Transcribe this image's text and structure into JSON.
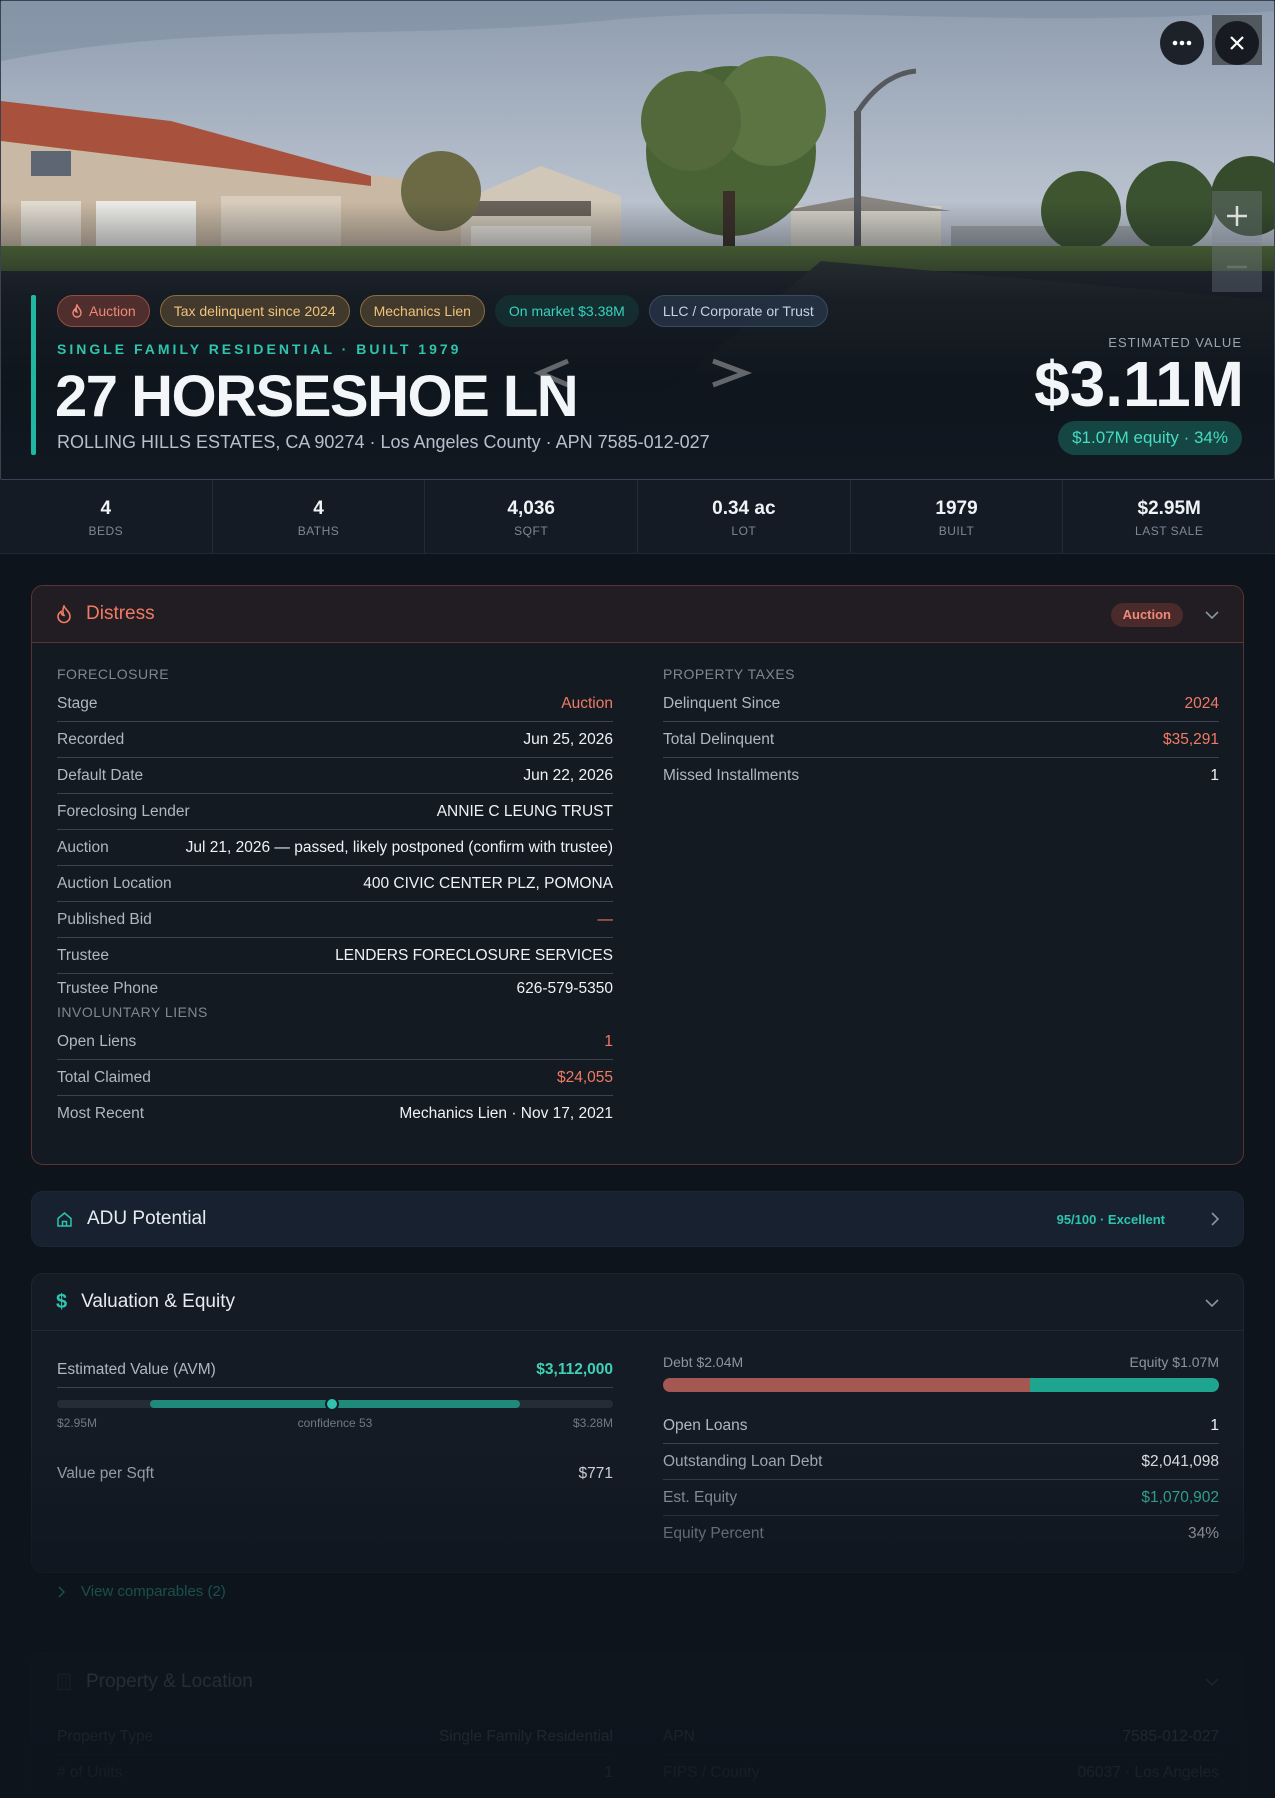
{
  "hero": {
    "tags": [
      {
        "label": "Auction"
      },
      {
        "label": "Tax delinquent since 2024"
      },
      {
        "label": "Mechanics Lien"
      },
      {
        "label": "On market $3.38M"
      },
      {
        "label": "LLC / Corporate or Trust"
      }
    ],
    "subtitle": "SINGLE FAMILY RESIDENTIAL · BUILT 1979",
    "address": "27 HORSESHOE LN",
    "location": "ROLLING HILLS ESTATES, CA 90274 · Los Angeles County · APN 7585-012-027",
    "estimated_label": "ESTIMATED VALUE",
    "estimated_value": "$3.11M",
    "equity": "$1.07M equity · 34%"
  },
  "stats": [
    {
      "value": "4",
      "label": "BEDS"
    },
    {
      "value": "4",
      "label": "BATHS"
    },
    {
      "value": "4,036",
      "label": "SQFT"
    },
    {
      "value": "0.34 ac",
      "label": "LOT"
    },
    {
      "value": "1979",
      "label": "BUILT"
    },
    {
      "value": "$2.95M",
      "label": "LAST SALE"
    }
  ],
  "distress": {
    "title": "Distress",
    "badge": "Auction",
    "foreclosure_label": "FORECLOSURE",
    "foreclosure": [
      {
        "k": "Stage",
        "v": "Auction"
      },
      {
        "k": "Recorded",
        "v": "Jun 25, 2026"
      },
      {
        "k": "Default Date",
        "v": "Jun 22, 2026"
      },
      {
        "k": "Foreclosing Lender",
        "v": "ANNIE C LEUNG TRUST"
      },
      {
        "k": "Auction",
        "v": "Jul 21, 2026 — passed, likely postponed (confirm with trustee)"
      },
      {
        "k": "Auction Location",
        "v": "400 CIVIC CENTER PLZ, POMONA"
      },
      {
        "k": "Published Bid",
        "v": "—"
      },
      {
        "k": "Trustee",
        "v": "LENDERS FORECLOSURE SERVICES"
      },
      {
        "k": "Trustee Phone",
        "v": "626-579-5350"
      }
    ],
    "liens_label": "INVOLUNTARY LIENS",
    "liens": [
      {
        "k": "Open Liens",
        "v": "1"
      },
      {
        "k": "Total Claimed",
        "v": "$24,055"
      },
      {
        "k": "Most Recent",
        "v": "Mechanics Lien · Nov 17, 2021"
      }
    ],
    "taxes_label": "PROPERTY TAXES",
    "taxes": [
      {
        "k": "Delinquent Since",
        "v": "2024"
      },
      {
        "k": "Total Delinquent",
        "v": "$35,291"
      },
      {
        "k": "Missed Installments",
        "v": "1"
      }
    ]
  },
  "adu": {
    "title": "ADU Potential",
    "score": "95/100 · Excellent"
  },
  "valuation": {
    "title": "Valuation & Equity",
    "avm_label": "Estimated Value (AVM)",
    "avm_value": "$3,112,000",
    "range_low": "$2.95M",
    "range_mid": "confidence 53",
    "range_high": "$3.28M",
    "range": {
      "low": 2950000,
      "high": 3280000,
      "estimate": 3112000
    },
    "vps_label": "Value per Sqft",
    "vps_value": "$771",
    "debt_label": "Debt $2.04M",
    "equity_label": "Equity $1.07M",
    "debt_share": 0.66,
    "rows": [
      {
        "k": "Open Loans",
        "v": "1"
      },
      {
        "k": "Outstanding Loan Debt",
        "v": "$2,041,098"
      },
      {
        "k": "Est. Equity",
        "v": "$1,070,902"
      },
      {
        "k": "Equity Percent",
        "v": "34%"
      }
    ],
    "comparables": "View comparables (2)"
  },
  "property": {
    "title": "Property & Location",
    "rows_left": [
      {
        "k": "Property Type",
        "v": "Single Family Residential"
      },
      {
        "k": "# of Units",
        "v": "1"
      }
    ],
    "rows_right": [
      {
        "k": "APN",
        "v": "7585-012-027"
      },
      {
        "k": "FIPS / County",
        "v": "06037 · Los Angeles"
      }
    ]
  },
  "colors": {
    "accent": "#21b8a2",
    "danger": "#f07a64",
    "background": "#0e141c"
  }
}
